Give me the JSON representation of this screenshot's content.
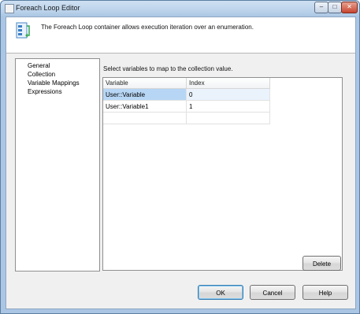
{
  "window": {
    "title": "Foreach Loop Editor",
    "controls": {
      "minimize": "–",
      "maximize": "□",
      "close": "✕"
    }
  },
  "header": {
    "description": "The Foreach Loop container allows execution iteration over an enumeration.",
    "icon": "foreach-loop-icon"
  },
  "nav": {
    "items": [
      "General",
      "Collection",
      "Variable Mappings",
      "Expressions"
    ],
    "selected": "Variable Mappings"
  },
  "mappings": {
    "prompt": "Select variables to map to the collection value.",
    "columns": [
      "Variable",
      "Index"
    ],
    "rows": [
      {
        "variable": "User::Variable",
        "index": "0"
      },
      {
        "variable": "User::Variable1",
        "index": "1"
      },
      {
        "variable": "",
        "index": ""
      }
    ],
    "selected_row": 0
  },
  "buttons": {
    "delete": "Delete",
    "ok": "OK",
    "cancel": "Cancel",
    "help": "Help"
  },
  "colors": {
    "selection": "#b7d6f5",
    "titlebar": "#b9d1ea"
  }
}
